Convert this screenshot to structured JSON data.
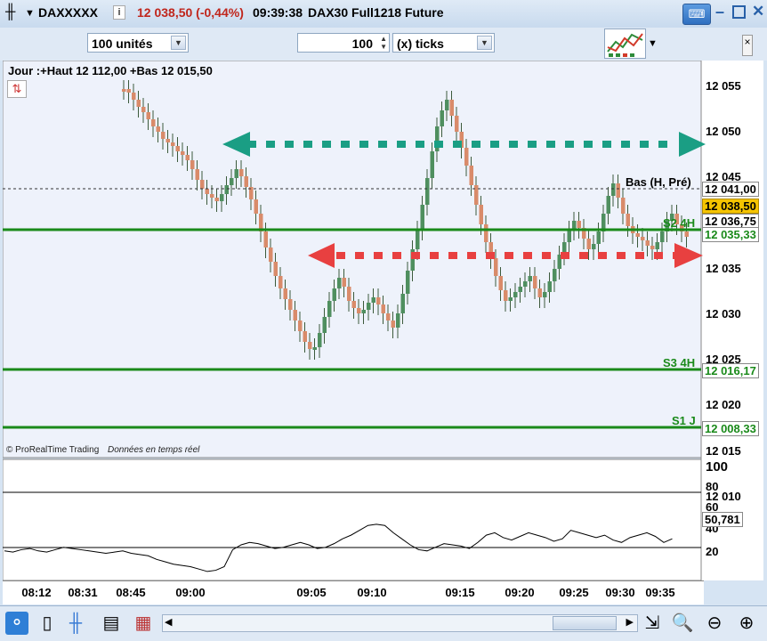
{
  "titlebar": {
    "instrument": "DAXXXXX",
    "info_icon": "i",
    "price_change": "12 038,50 (-0,44%)",
    "time": "09:39:38",
    "contract": "DAX30 Full1218 Future"
  },
  "toolbar": {
    "units_value": "100 unités",
    "ticks_value": "100",
    "ticks_mode": "(x) ticks"
  },
  "chart": {
    "header": "Jour :+Haut 12 112,00 +Bas 12 015,50",
    "copyright": "© ProRealTime Trading",
    "realtime": "Données en temps réel",
    "overlap_label": "Bas (H, Pré)",
    "price_tag": "12 038,50",
    "tag_12041": "12 041,00",
    "tag_12036": "12 036,75",
    "s2_label": "S2 4H",
    "s2_value": "12 035,33",
    "s3_label": "S3 4H",
    "s3_value": "12 016,17",
    "s1_label": "S1 J",
    "s1_value": "12 008,33",
    "y_ticks": [
      "12 055",
      "12 050",
      "12 045",
      "12 040",
      "12 035",
      "12 030",
      "12 025",
      "12 020",
      "12 015",
      "12 010"
    ]
  },
  "indicator": {
    "y_ticks": [
      "100",
      "80",
      "60",
      "40",
      "20"
    ],
    "value_tag": "50,781"
  },
  "xaxis": [
    "08:12",
    "08:31",
    "08:45",
    "09:00",
    "09:05",
    "09:10",
    "09:15",
    "09:20",
    "09:25",
    "09:30",
    "09:35"
  ],
  "colors": {
    "up": "#4f8f5f",
    "down": "#d98b6a",
    "support": "#1a8a1a",
    "arrow_green": "#1a9e84",
    "arrow_red": "#e84040",
    "price_tag_bg": "#f5c400"
  }
}
